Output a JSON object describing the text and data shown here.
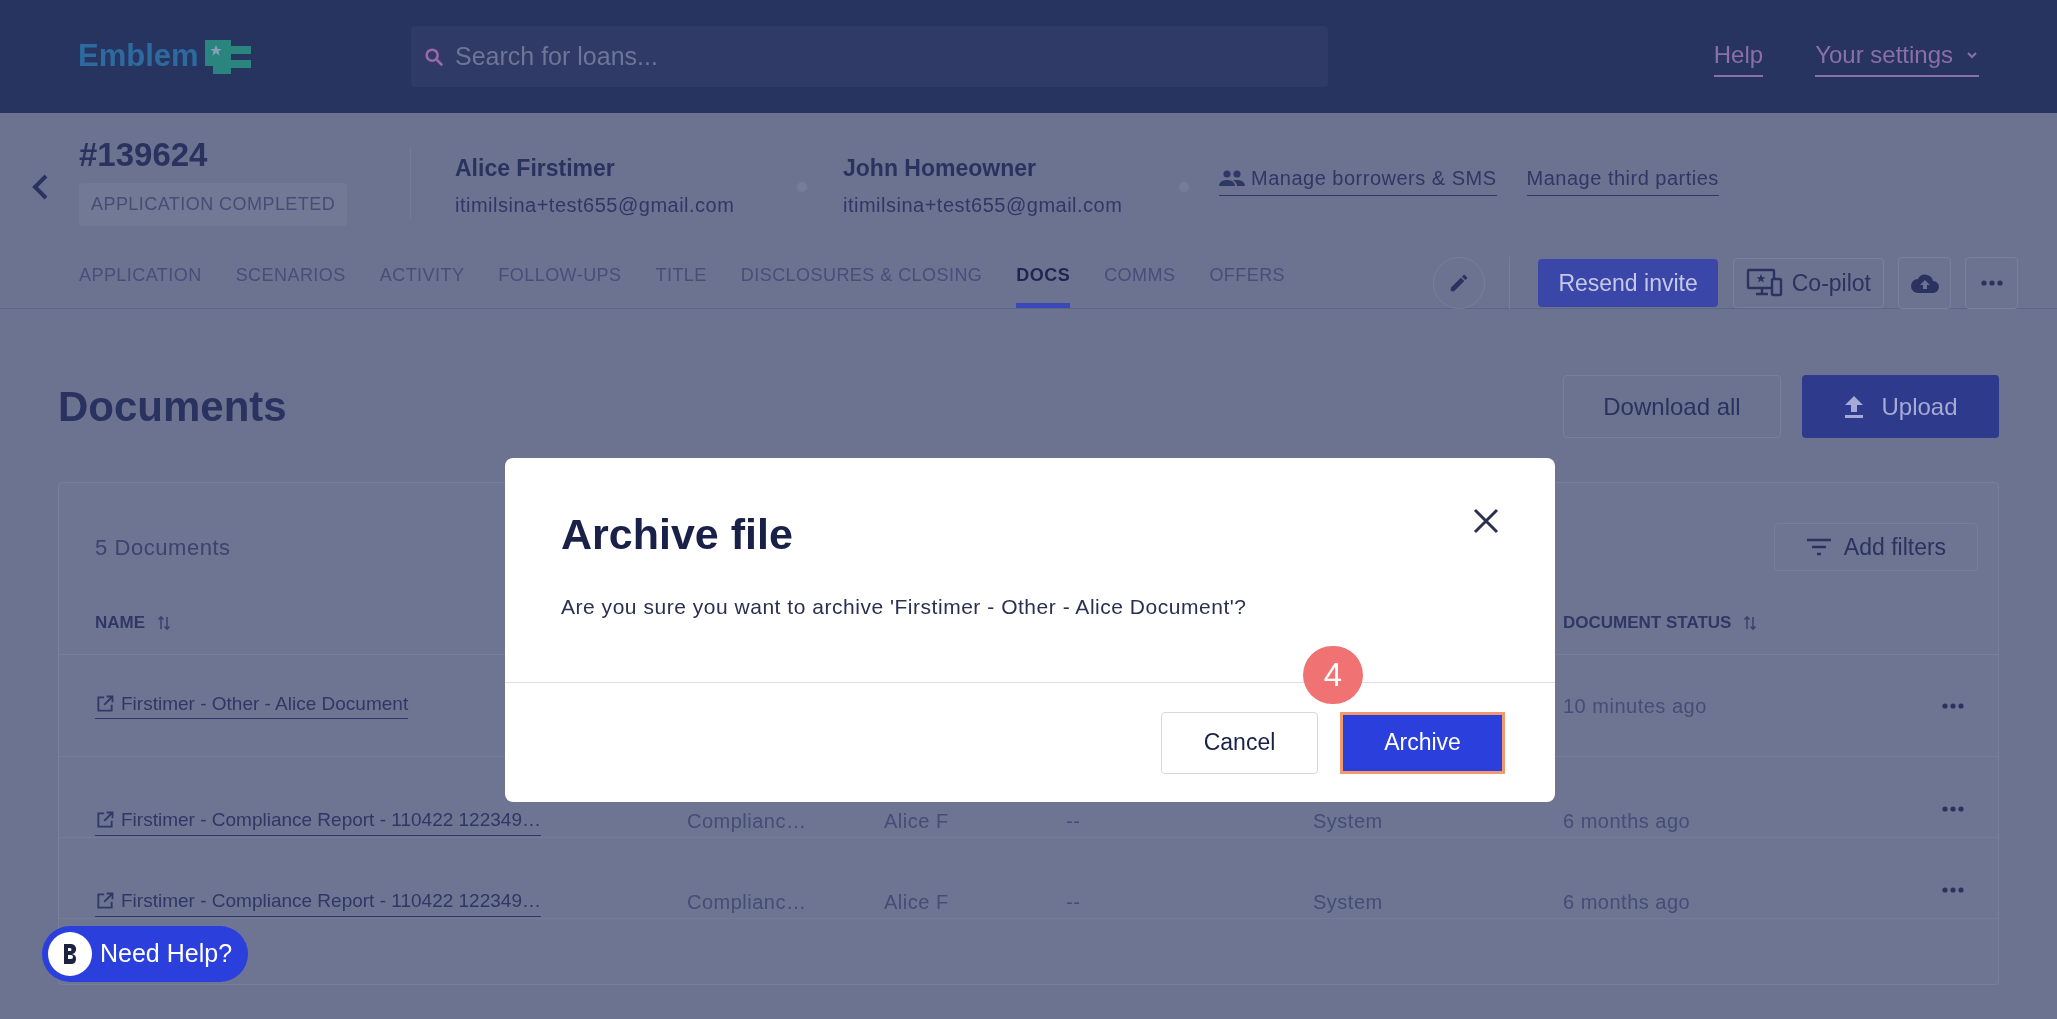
{
  "header": {
    "logo": "Emblem",
    "search": {
      "placeholder": "Search for loans..."
    },
    "links": [
      "Help",
      "Your settings"
    ]
  },
  "loan": {
    "number": "#139624",
    "status": "APPLICATION COMPLETED",
    "borrowers": [
      {
        "name": "Alice Firstimer",
        "email": "itimilsina+test655@gmail.com"
      },
      {
        "name": "John Homeowner",
        "email": "itimilsina+test655@gmail.com"
      }
    ],
    "links": [
      "Manage borrowers & SMS",
      "Manage third parties"
    ]
  },
  "tabs": [
    {
      "label": "APPLICATION",
      "selected": false
    },
    {
      "label": "SCENARIOS",
      "selected": false
    },
    {
      "label": "ACTIVITY",
      "selected": false
    },
    {
      "label": "FOLLOW-UPS",
      "selected": false
    },
    {
      "label": "TITLE",
      "selected": false
    },
    {
      "label": "DISCLOSURES & CLOSING",
      "selected": false
    },
    {
      "label": "DOCS",
      "selected": true
    },
    {
      "label": "COMMS",
      "selected": false
    },
    {
      "label": "OFFERS",
      "selected": false
    }
  ],
  "actions": {
    "resend": "Resend invite",
    "copilot": "Co-pilot"
  },
  "page": {
    "title": "Documents",
    "download": "Download all",
    "upload": "Upload"
  },
  "documents": {
    "count": "5 Documents",
    "filter": "Add filters",
    "columns": {
      "name": "NAME",
      "status": "DOCUMENT STATUS"
    },
    "rows": [
      {
        "name": "Firstimer - Other - Alice Document",
        "status": "10 minutes ago"
      },
      {
        "name": "Firstimer - Compliance Report - 110422 122349…",
        "column_2": "Complianc…",
        "column_3": "Alice F",
        "column_4": "--",
        "column_5": "System",
        "status": "6 months ago"
      },
      {
        "name": "Firstimer - Compliance Report - 110422 122349…",
        "column_2": "Complianc…",
        "column_3": "Alice F",
        "column_4": "--",
        "column_5": "System",
        "status": "6 months ago"
      }
    ]
  },
  "help": "Need Help?",
  "dialog": {
    "title": "Archive file",
    "message": "Are you sure you want to archive 'Firstimer - Other - Alice Document'?",
    "cancel": "Cancel",
    "confirm": "Archive",
    "step": "4"
  }
}
